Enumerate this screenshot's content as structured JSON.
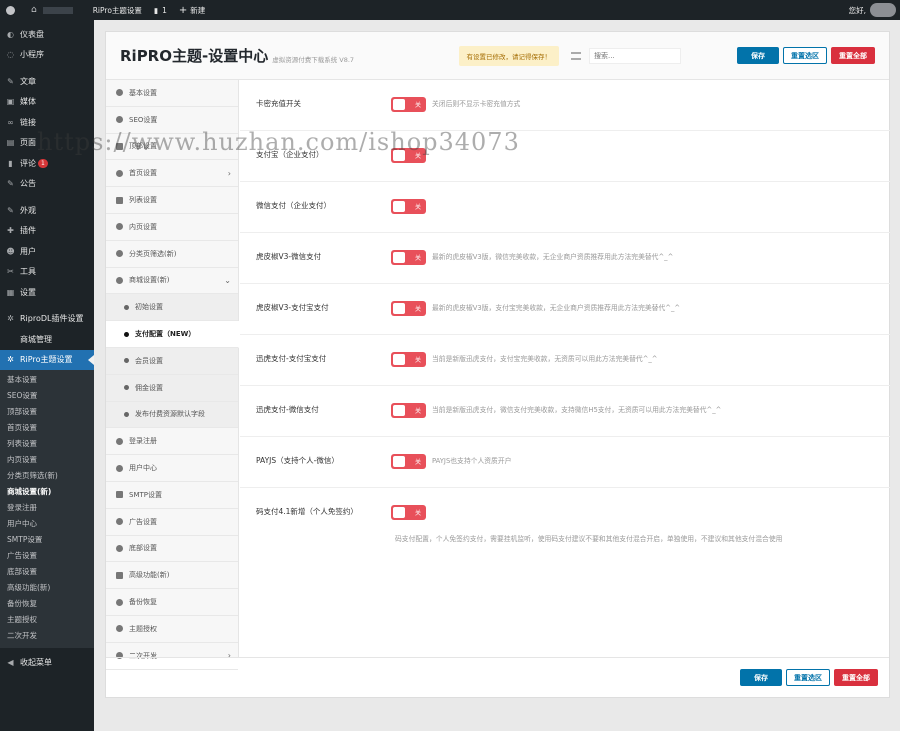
{
  "adminbar": {
    "site": "RiPro主题设置",
    "comments": "1",
    "new": "新建",
    "greeting": "您好,"
  },
  "menu": {
    "items": [
      {
        "label": "仪表盘",
        "icon": "dashboard-icon"
      },
      {
        "label": "小程序",
        "icon": "miniprogram-icon"
      },
      {
        "label": "文章",
        "icon": "pin-icon"
      },
      {
        "label": "媒体",
        "icon": "media-icon"
      },
      {
        "label": "链接",
        "icon": "link-icon"
      },
      {
        "label": "页面",
        "icon": "page-icon"
      },
      {
        "label": "评论",
        "icon": "comment-icon",
        "badge": "1"
      },
      {
        "label": "公告",
        "icon": "pin-icon"
      },
      {
        "label": "外观",
        "icon": "brush-icon"
      },
      {
        "label": "插件",
        "icon": "plugin-icon"
      },
      {
        "label": "用户",
        "icon": "user-icon"
      },
      {
        "label": "工具",
        "icon": "wrench-icon"
      },
      {
        "label": "设置",
        "icon": "settings-icon"
      },
      {
        "label": "RiproDL插件设置",
        "icon": "gear-icon"
      },
      {
        "label": "商城管理",
        "icon": "blank-icon"
      },
      {
        "label": "RiPro主题设置",
        "icon": "gear-icon"
      }
    ],
    "submenu": [
      "基本设置",
      "SEO设置",
      "顶部设置",
      "首页设置",
      "列表设置",
      "内页设置",
      "分类页筛选(新)",
      "商城设置(新)",
      "登录注册",
      "用户中心",
      "SMTP设置",
      "广告设置",
      "底部设置",
      "高级功能(新)",
      "备份恢复",
      "主题授权",
      "二次开发"
    ],
    "collapse": "收起菜单"
  },
  "header": {
    "title": "RiPRO主题-设置中心",
    "subtitle": "虚拟资源付费下载系统 V8.7",
    "notice": "有设置已修改，请记得保存！",
    "search_placeholder": "搜索...",
    "save": "保存",
    "reset_section": "重置选区",
    "reset_all": "重置全部"
  },
  "nav": [
    {
      "label": "基本设置",
      "icon": "paper-plane-icon"
    },
    {
      "label": "SEO设置",
      "icon": "circle-icon"
    },
    {
      "label": "顶部设置",
      "icon": "square-icon"
    },
    {
      "label": "首页设置",
      "icon": "home-icon",
      "arrow": "›"
    },
    {
      "label": "列表设置",
      "icon": "list-icon"
    },
    {
      "label": "内页设置",
      "icon": "circle-icon"
    },
    {
      "label": "分类页筛选(新)",
      "icon": "circle-icon"
    },
    {
      "label": "商城设置(新)",
      "icon": "gear-icon",
      "arrow": "⌄"
    },
    {
      "label": "初始设置",
      "icon": "dot-icon",
      "sub": true
    },
    {
      "label": "支付配置（NEW）",
      "icon": "dot-icon",
      "sub": true,
      "current": true
    },
    {
      "label": "会员设置",
      "icon": "dot-icon",
      "sub": true
    },
    {
      "label": "佣金设置",
      "icon": "dot-icon",
      "sub": true
    },
    {
      "label": "发布付费资源默认字段",
      "icon": "dot-icon",
      "sub": true
    },
    {
      "label": "登录注册",
      "icon": "user-icon"
    },
    {
      "label": "用户中心",
      "icon": "user-icon"
    },
    {
      "label": "SMTP设置",
      "icon": "mail-icon"
    },
    {
      "label": "广告设置",
      "icon": "bullhorn-icon"
    },
    {
      "label": "底部设置",
      "icon": "circle-icon"
    },
    {
      "label": "高级功能(新)",
      "icon": "square-icon"
    },
    {
      "label": "备份恢复",
      "icon": "shield-icon"
    },
    {
      "label": "主题授权",
      "icon": "eye-icon"
    },
    {
      "label": "二次开发",
      "icon": "wrench-icon",
      "arrow": "›"
    }
  ],
  "settings": [
    {
      "label": "卡密充值开关",
      "toggle": "关",
      "desc": "关闭后则不显示卡密充值方式"
    },
    {
      "label": "支付宝（企业支付）",
      "toggle": "关",
      "desc": ""
    },
    {
      "label": "微信支付（企业支付）",
      "toggle": "关",
      "desc": ""
    },
    {
      "label": "虎皮椒V3-微信支付",
      "toggle": "关",
      "desc": "最新的虎皮椒V3版，微信完美收款，无企业商户资质推荐用此方法完美替代^_^"
    },
    {
      "label": "虎皮椒V3-支付宝支付",
      "toggle": "关",
      "desc": "最新的虎皮椒V3版，支付宝完美收款，无企业商户资质推荐用此方法完美替代^_^"
    },
    {
      "label": "迅虎支付-支付宝支付",
      "toggle": "关",
      "desc": "当前是新版迅虎支付，支付宝完美收款，无资质可以用此方法完美替代^_^"
    },
    {
      "label": "迅虎支付-微信支付",
      "toggle": "关",
      "desc": "当前是新版迅虎支付，微信支付完美收款，支持微信H5支付，无资质可以用此方法完美替代^_^"
    },
    {
      "label": "PAYJS（支持个人-微信）",
      "toggle": "关",
      "desc": "PAYJS也支持个人资质开户"
    },
    {
      "label": "码支付4.1新增（个人免签约）",
      "toggle": "关",
      "desc": "码支付配置，个人免签约支付，需要挂机监听，使用码支付建议不要和其他支付混合开启，单独使用，不建议和其他支付混合使用"
    }
  ],
  "watermark": "https://www.huzhan.com/ishop34073"
}
